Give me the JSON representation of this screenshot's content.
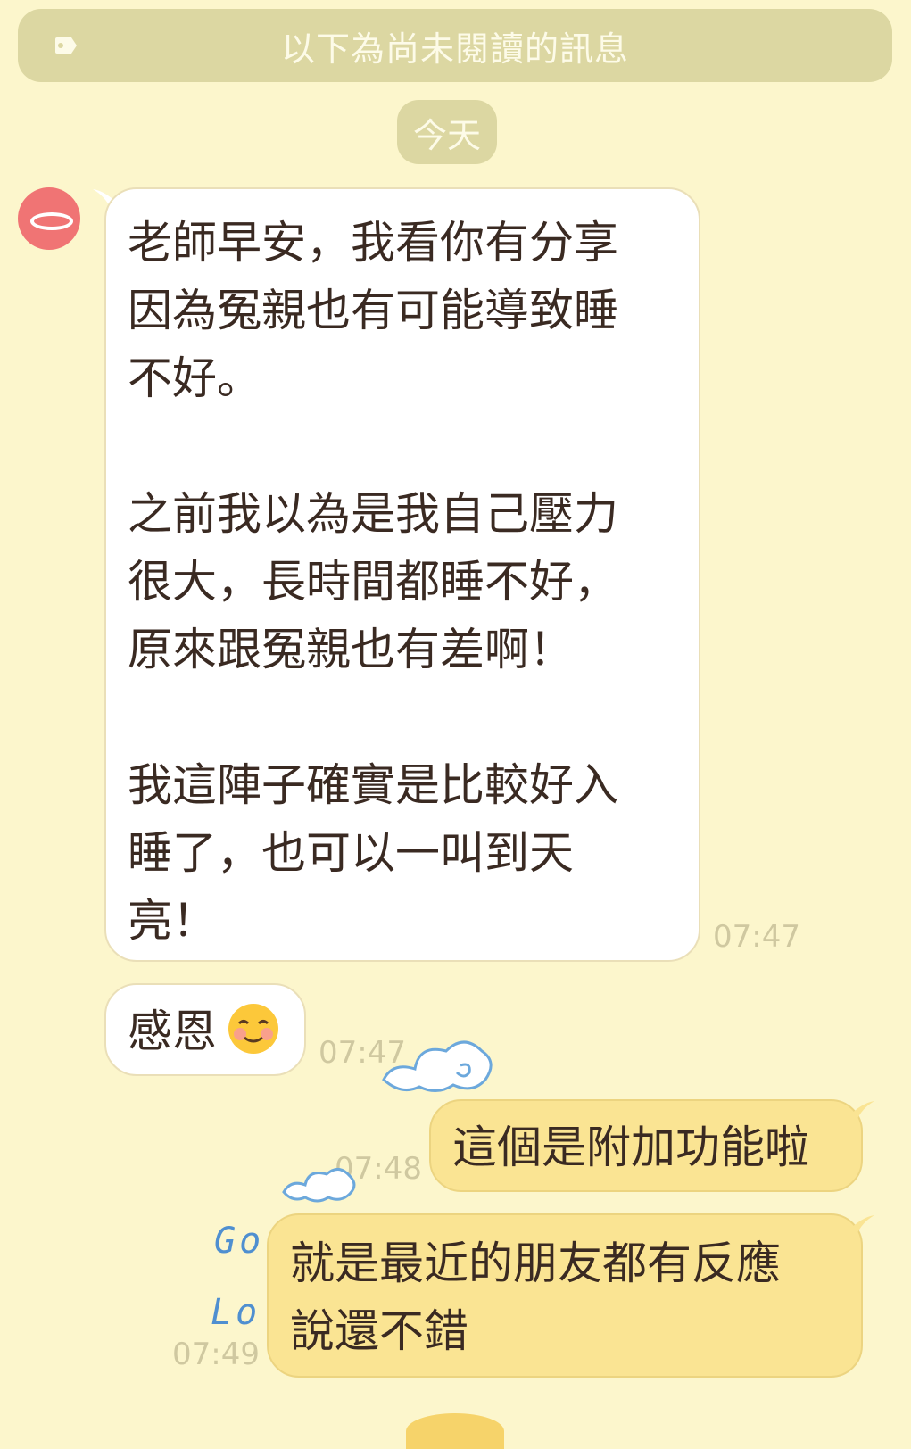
{
  "unread_banner": {
    "label": "以下為尚未閱讀的訊息",
    "icon": "tag-icon"
  },
  "date_divider": {
    "label": "今天"
  },
  "messages": [
    {
      "side": "incoming",
      "text": "老師早安，我看你有分享\n因為冤親也有可能導致睡\n不好。\n\n之前我以為是我自己壓力\n很大，長時間都睡不好，\n原來跟冤親也有差啊！\n\n我這陣子確實是比較好入\n睡了，也可以一叫到天\n亮！",
      "time": "07:47"
    },
    {
      "side": "incoming",
      "text": "感恩",
      "emoji": "☺️",
      "time": "07:47"
    },
    {
      "side": "outgoing",
      "text": "這個是附加功能啦",
      "time": "07:48"
    },
    {
      "side": "outgoing",
      "text": "就是最近的朋友都有反應\n說還不錯",
      "time": "07:49"
    }
  ],
  "decor": {
    "word1": "Go",
    "word2": "Lo"
  },
  "colors": {
    "background": "#fcf6cc",
    "incoming_bubble": "#ffffff",
    "outgoing_bubble": "#fae493",
    "banner": "#dcd7a2",
    "avatar": "#f07474"
  }
}
